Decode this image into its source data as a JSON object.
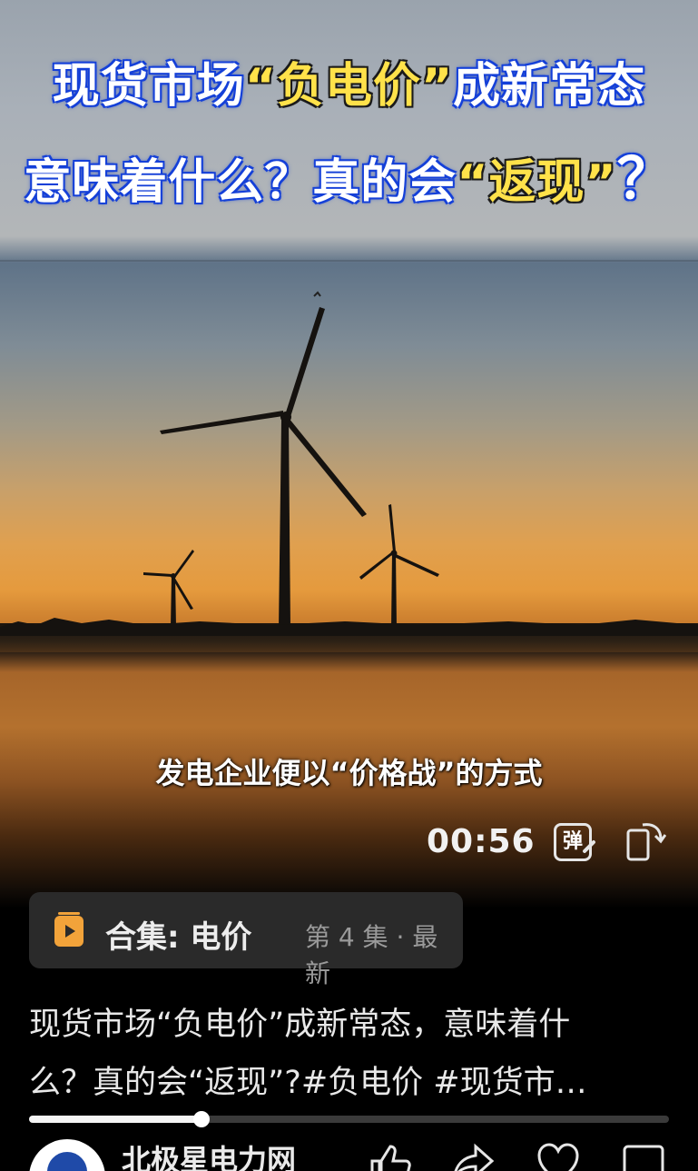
{
  "video": {
    "title_line1_a": "现货市场",
    "title_line1_quote": "“负电价”",
    "title_line1_b": "成新常态",
    "title_line2_a": "意味着什么？真的会",
    "title_line2_quote": "“返现”",
    "title_line2_q": "？",
    "subtitle": "发电企业便以“价格战”的方式",
    "time": "00:56",
    "danmaku_label": "弹",
    "progress_fraction": 0.27
  },
  "collection": {
    "label": "合集: 电价",
    "episode": "第 4 集 · 最新"
  },
  "description": {
    "line1": "现货市场“负电价”成新常态，意味着什",
    "line2": "么？真的会“返现”?#负电价 #现货市…"
  },
  "author": {
    "name": "北极星电力网"
  },
  "icons": {
    "collection": "collection-play-icon",
    "danmaku": "danmaku-icon",
    "rotate": "rotate-screen-icon",
    "like": "thumbs-up-icon",
    "share": "share-icon",
    "favorite": "heart-icon",
    "comment": "comment-icon"
  },
  "colors": {
    "title_outline": "#1641d8",
    "title_highlight": "#ffe24a",
    "collection_accent": "#f2a33a"
  }
}
